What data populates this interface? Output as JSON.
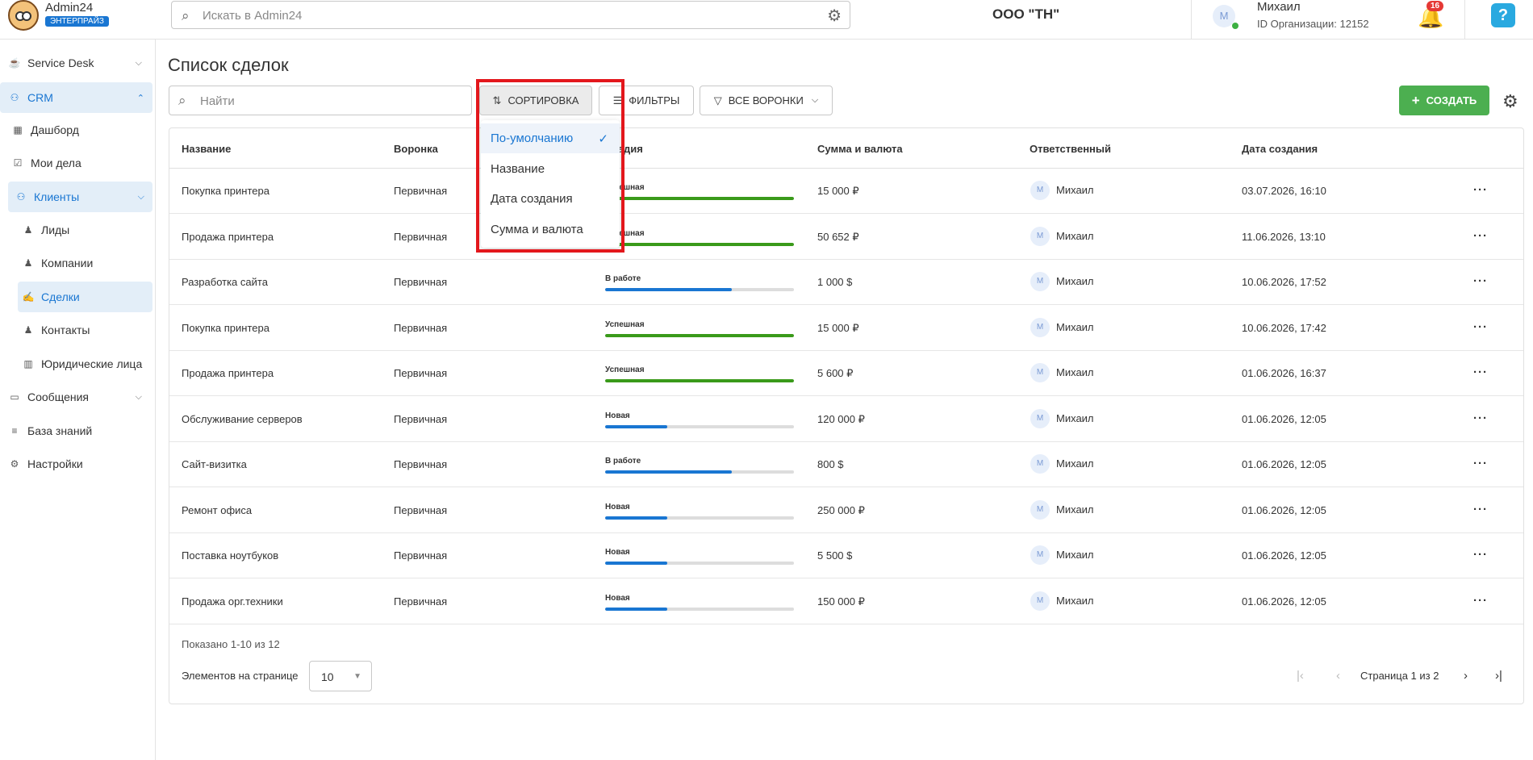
{
  "app": {
    "name": "Admin24",
    "badge": "ЭНТЕРПРАЙЗ"
  },
  "header": {
    "search_placeholder": "Искать в Admin24",
    "org_name": "ООО \"ТН\"",
    "user": {
      "initial": "М",
      "name": "Михаил",
      "org_id": "ID Организации: 12152"
    },
    "notifications": "16",
    "help": "?"
  },
  "sidebar": {
    "items": [
      {
        "label": "Service Desk",
        "icon": "headset-icon"
      },
      {
        "label": "CRM",
        "icon": "people-icon"
      },
      {
        "label": "Дашборд",
        "icon": "dashboard-icon"
      },
      {
        "label": "Мои дела",
        "icon": "calendar-check-icon"
      },
      {
        "label": "Клиенты",
        "icon": "people-icon"
      },
      {
        "label": "Лиды",
        "icon": "person-icon"
      },
      {
        "label": "Компании",
        "icon": "person-icon"
      },
      {
        "label": "Сделки",
        "icon": "handshake-icon"
      },
      {
        "label": "Контакты",
        "icon": "person-icon"
      },
      {
        "label": "Юридические лица",
        "icon": "building-icon"
      },
      {
        "label": "Сообщения",
        "icon": "chat-icon"
      },
      {
        "label": "База знаний",
        "icon": "database-icon"
      },
      {
        "label": "Настройки",
        "icon": "gear-icon"
      }
    ]
  },
  "page": {
    "title": "Список сделок",
    "find_placeholder": "Найти",
    "sort_label": "СОРТИРОВКА",
    "filters_label": "ФИЛЬТРЫ",
    "funnels_label": "ВСЕ ВОРОНКИ",
    "create_label": "СОЗДАТЬ"
  },
  "sort_menu": {
    "options": [
      "По-умолчанию",
      "Название",
      "Дата создания",
      "Сумма и валюта"
    ],
    "selected": "По-умолчанию"
  },
  "table": {
    "columns": [
      "Название",
      "Воронка",
      "Стадия",
      "Сумма и валюта",
      "Ответственный",
      "Дата создания"
    ],
    "rows": [
      {
        "name": "Покупка принтера",
        "funnel": "Первичная",
        "stage": "Успешная",
        "progress": 1.0,
        "amount": "15 000 ₽",
        "resp": "Михаил",
        "date": "03.07.2026, 16:10"
      },
      {
        "name": "Продажа принтера",
        "funnel": "Первичная",
        "stage": "Успешная",
        "progress": 1.0,
        "amount": "50 652 ₽",
        "resp": "Михаил",
        "date": "11.06.2026, 13:10"
      },
      {
        "name": "Разработка сайта",
        "funnel": "Первичная",
        "stage": "В работе",
        "progress": 0.67,
        "amount": "1 000 $",
        "resp": "Михаил",
        "date": "10.06.2026, 17:52"
      },
      {
        "name": "Покупка принтера",
        "funnel": "Первичная",
        "stage": "Успешная",
        "progress": 1.0,
        "amount": "15 000 ₽",
        "resp": "Михаил",
        "date": "10.06.2026, 17:42"
      },
      {
        "name": "Продажа принтера",
        "funnel": "Первичная",
        "stage": "Успешная",
        "progress": 1.0,
        "amount": "5 600 ₽",
        "resp": "Михаил",
        "date": "01.06.2026, 16:37"
      },
      {
        "name": "Обслуживание серверов",
        "funnel": "Первичная",
        "stage": "Новая",
        "progress": 0.33,
        "amount": "120 000 ₽",
        "resp": "Михаил",
        "date": "01.06.2026, 12:05"
      },
      {
        "name": "Сайт-визитка",
        "funnel": "Первичная",
        "stage": "В работе",
        "progress": 0.67,
        "amount": "800 $",
        "resp": "Михаил",
        "date": "01.06.2026, 12:05"
      },
      {
        "name": "Ремонт офиса",
        "funnel": "Первичная",
        "stage": "Новая",
        "progress": 0.33,
        "amount": "250 000 ₽",
        "resp": "Михаил",
        "date": "01.06.2026, 12:05"
      },
      {
        "name": "Поставка ноутбуков",
        "funnel": "Первичная",
        "stage": "Новая",
        "progress": 0.33,
        "amount": "5 500 $",
        "resp": "Михаил",
        "date": "01.06.2026, 12:05"
      },
      {
        "name": "Продажа орг.техники",
        "funnel": "Первичная",
        "stage": "Новая",
        "progress": 0.33,
        "amount": "150 000 ₽",
        "resp": "Михаил",
        "date": "01.06.2026, 12:05"
      }
    ],
    "resp_initial": "М"
  },
  "footer": {
    "shown": "Показано 1-10 из 12",
    "per_page_label": "Элементов на странице",
    "per_page": "10",
    "page_text": "Страница 1 из 2"
  },
  "colors": {
    "success": "#3a9a1a",
    "progress": "#1976d2",
    "accent": "#1976d2",
    "create": "#4caf50",
    "highlight": "#e3171c"
  }
}
